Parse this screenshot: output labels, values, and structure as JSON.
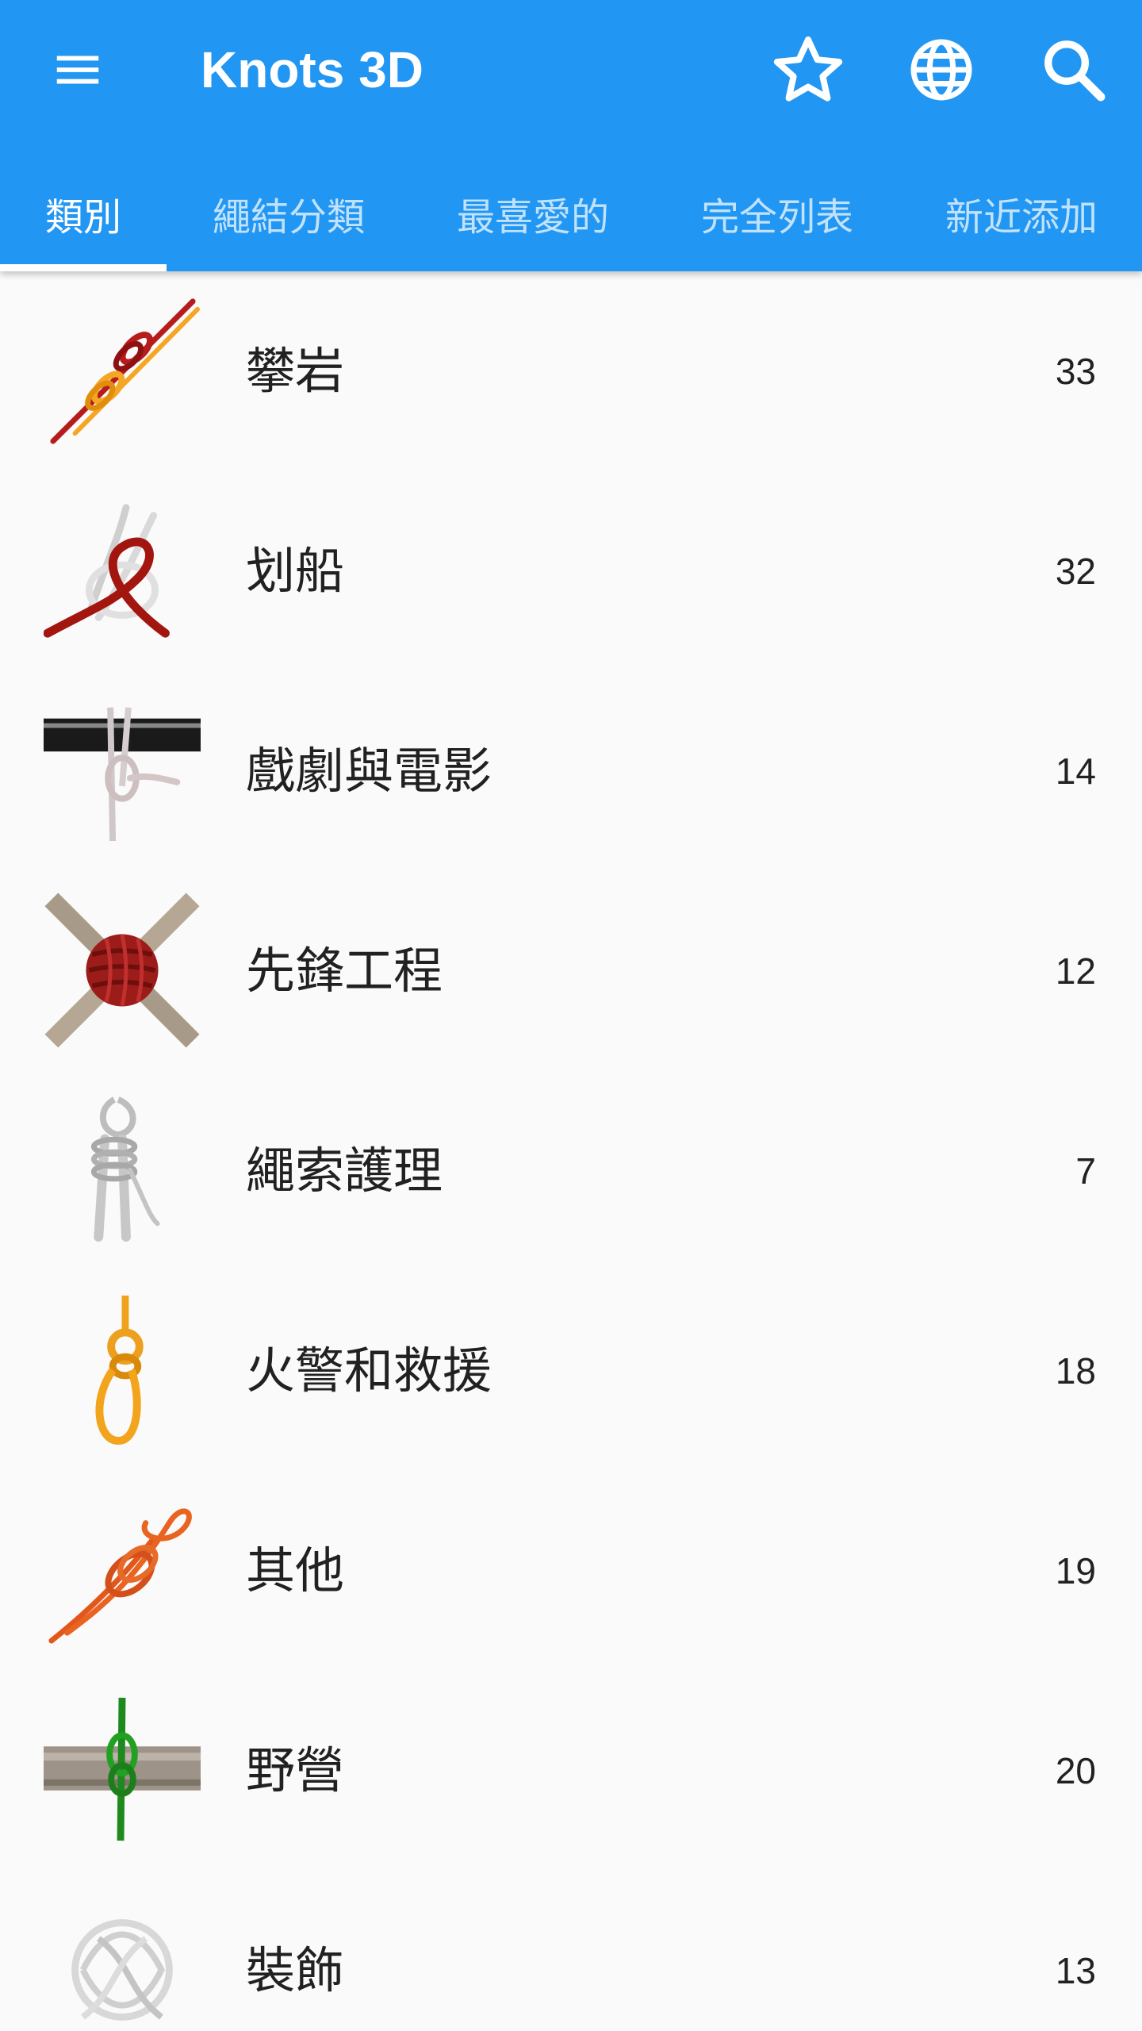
{
  "app": {
    "title": "Knots 3D"
  },
  "toolbar": {
    "icons": [
      "menu-icon",
      "star-icon",
      "globe-icon",
      "search-icon"
    ]
  },
  "tabs": [
    {
      "label": "類別",
      "active": true
    },
    {
      "label": "繩結分類",
      "active": false
    },
    {
      "label": "最喜愛的",
      "active": false
    },
    {
      "label": "完全列表",
      "active": false
    },
    {
      "label": "新近添加",
      "active": false
    }
  ],
  "categories": [
    {
      "label": "攀岩",
      "count": "33",
      "thumb": "climbing-knot-icon"
    },
    {
      "label": "划船",
      "count": "32",
      "thumb": "boating-knot-icon"
    },
    {
      "label": "戲劇與電影",
      "count": "14",
      "thumb": "theatre-knot-icon"
    },
    {
      "label": "先鋒工程",
      "count": "12",
      "thumb": "pioneering-lashing-icon"
    },
    {
      "label": "繩索護理",
      "count": "7",
      "thumb": "rope-coil-icon"
    },
    {
      "label": "火警和救援",
      "count": "18",
      "thumb": "rescue-knot-icon"
    },
    {
      "label": "其他",
      "count": "19",
      "thumb": "other-knot-icon"
    },
    {
      "label": "野營",
      "count": "20",
      "thumb": "camping-knot-icon"
    },
    {
      "label": "裝飾",
      "count": "13",
      "thumb": "decorative-knot-icon"
    }
  ],
  "colors": {
    "primary": "#2196f3",
    "background": "#fafafa",
    "text": "#212121"
  }
}
